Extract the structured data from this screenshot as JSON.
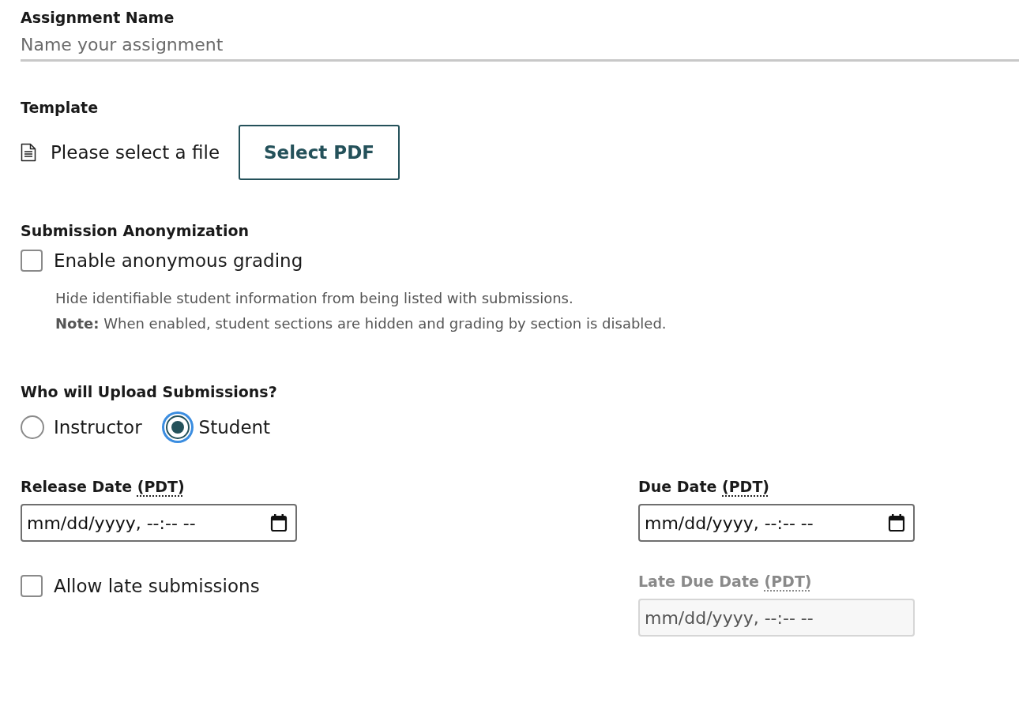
{
  "assignment_name": {
    "label": "Assignment Name",
    "placeholder": "Name your assignment"
  },
  "template": {
    "label": "Template",
    "file_status": "Please select a file",
    "button": "Select PDF"
  },
  "anonymization": {
    "label": "Submission Anonymization",
    "checkbox": {
      "label": "Enable anonymous grading",
      "checked": false
    },
    "help": [
      "Hide identifiable student information from being listed with submissions.",
      "**Note:** When enabled, student sections are hidden and grading by section is disabled."
    ]
  },
  "uploader": {
    "label": "Who will Upload Submissions?",
    "options": [
      {
        "label": "Instructor",
        "selected": false,
        "focused": false
      },
      {
        "label": "Student",
        "selected": true,
        "focused": true
      }
    ]
  },
  "release_date": {
    "label": "Release Date",
    "timezone": "(PDT)",
    "placeholder": "mm/dd/yyyy, --:-- --",
    "disabled": false
  },
  "due_date": {
    "label": "Due Date",
    "timezone": "(PDT)",
    "placeholder": "mm/dd/yyyy, --:-- --",
    "disabled": false
  },
  "late_submissions": {
    "label": "Allow late submissions",
    "checked": false
  },
  "late_due_date": {
    "label": "Late Due Date",
    "timezone": "(PDT)",
    "placeholder": "mm/dd/yyyy, --:-- --",
    "disabled": true
  }
}
